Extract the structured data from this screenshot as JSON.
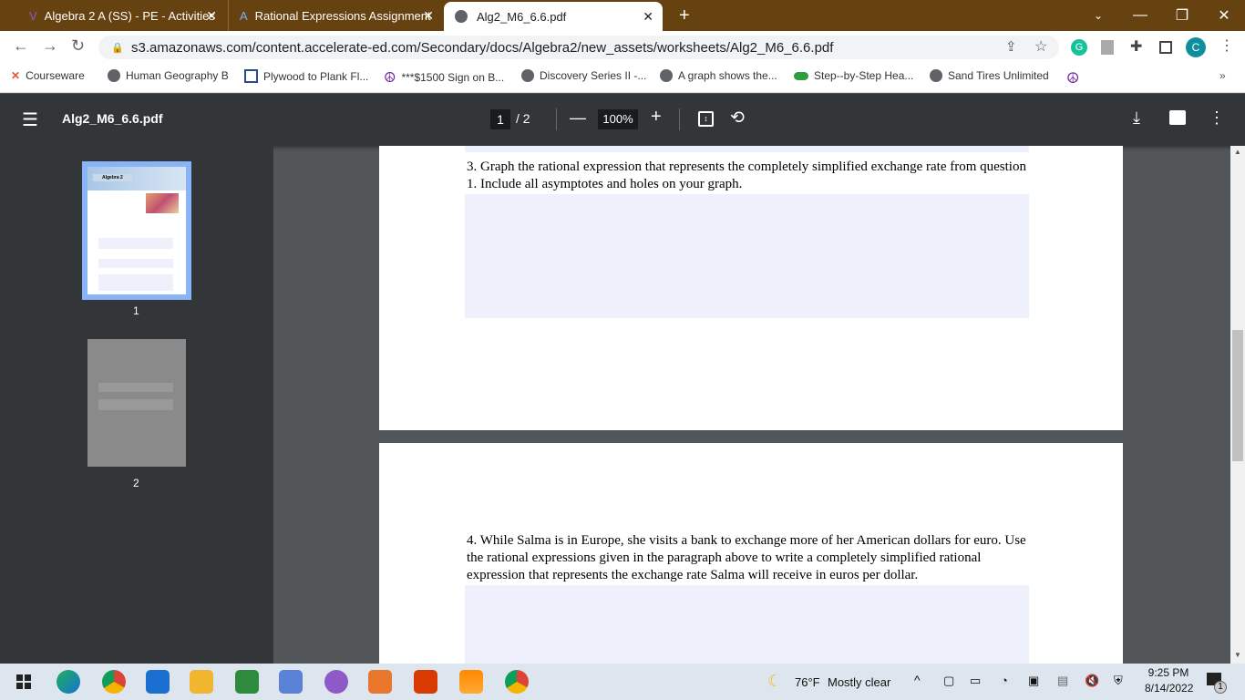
{
  "browser": {
    "tabs": [
      {
        "label": "Algebra 2 A (SS) - PE - Activities"
      },
      {
        "label": "Rational Expressions Assignment"
      },
      {
        "label": "Alg2_M6_6.6.pdf",
        "active": true
      }
    ],
    "new_tab": "+",
    "url": "s3.amazonaws.com/content.accelerate-ed.com/Secondary/docs/Algebra2/new_assets/worksheets/Alg2_M6_6.6.pdf",
    "profile_initial": "C",
    "bookmarks": [
      "Courseware",
      "Human Geography B",
      "Plywood to Plank Fl...",
      "***$1500 Sign on B...",
      "Discovery Series II -...",
      "A graph shows the...",
      "Step--by-Step Hea...",
      "Sand Tires Unlimited"
    ],
    "accent": "#674211"
  },
  "pdf": {
    "title": "Alg2_M6_6.6.pdf",
    "page_current": "1",
    "page_total": "/ 2",
    "zoom": "100%",
    "thumbnails": [
      {
        "label": "1",
        "selected": true
      },
      {
        "label": "2"
      }
    ],
    "thumb_header": "Algebra 2",
    "q3": "3. Graph the rational expression that represents the completely simplified exchange rate from question 1. Include all asymptotes and holes on your graph.",
    "q4": "4. While Salma is in Europe, she visits a bank to exchange more of her American dollars for euro. Use the rational expressions given in the paragraph above to write a completely simplified rational expression that represents the exchange rate Salma will receive in euros per dollar."
  },
  "taskbar": {
    "weather_temp": "76°F",
    "weather_desc": "Mostly clear",
    "time": "9:25 PM",
    "date": "8/14/2022",
    "notifications": "1"
  }
}
